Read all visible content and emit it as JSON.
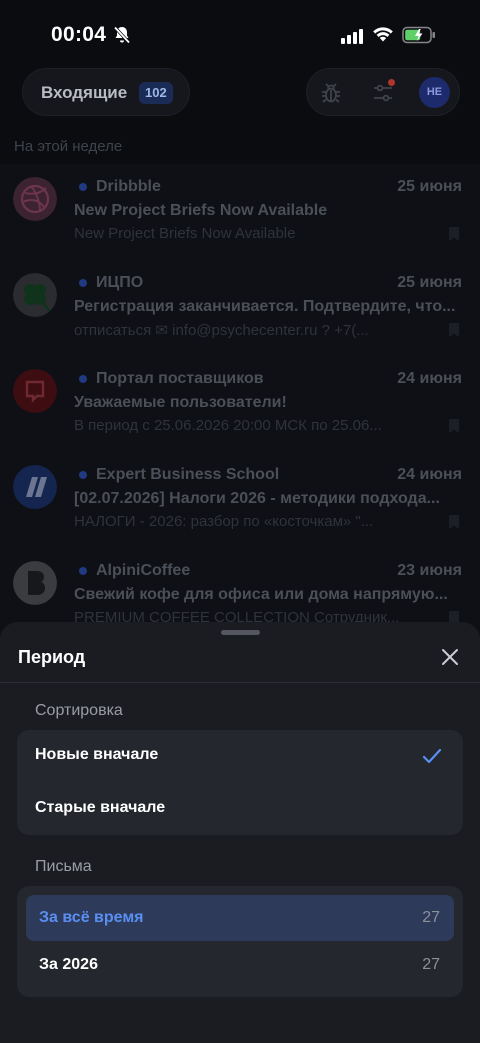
{
  "status": {
    "time": "00:04"
  },
  "header": {
    "inbox_label": "Входящие",
    "inbox_count": "102",
    "avatar_initials": "НЕ"
  },
  "section_label": "На этой неделе",
  "mails": [
    {
      "sender": "Dribbble",
      "date": "25 июня",
      "subject": "New Project Briefs Now Available",
      "preview": "New Project Briefs Now Available"
    },
    {
      "sender": "ИЦПО",
      "date": "25 июня",
      "subject": "Регистрация заканчивается. Подтвердите, что...",
      "preview": "отписаться ✉ info@psychecenter.ru ? +7(..."
    },
    {
      "sender": "Портал поставщиков",
      "date": "24 июня",
      "subject": "Уважаемые пользователи!",
      "preview": "В период с 25.06.2026 20:00 МСК по 25.06..."
    },
    {
      "sender": "Expert Business School",
      "date": "24 июня",
      "subject": "[02.07.2026] Налоги 2026 - методики подхода...",
      "preview": "НАЛОГИ - 2026: разбор по «косточкам» \"..."
    },
    {
      "sender": "AlpiniCoffee",
      "date": "23 июня",
      "subject": "Свежий кофе для офиса или дома напрямую...",
      "preview": "PREMIUM COFFEE COLLECTION Сотрудник..."
    }
  ],
  "sheet": {
    "title": "Период",
    "sort_label": "Сортировка",
    "sort_options": [
      {
        "label": "Новые вначале",
        "selected": true
      },
      {
        "label": "Старые вначале",
        "selected": false
      }
    ],
    "letters_label": "Письма",
    "letters_options": [
      {
        "label": "За всё время",
        "count": "27",
        "selected": true
      },
      {
        "label": "За 2026",
        "count": "27",
        "selected": false
      }
    ]
  },
  "colors": {
    "accent": "#5a8ff2",
    "sheet_bg": "#1a1c22",
    "card_bg": "#24272e",
    "selected_bg": "#2d3a5a"
  }
}
